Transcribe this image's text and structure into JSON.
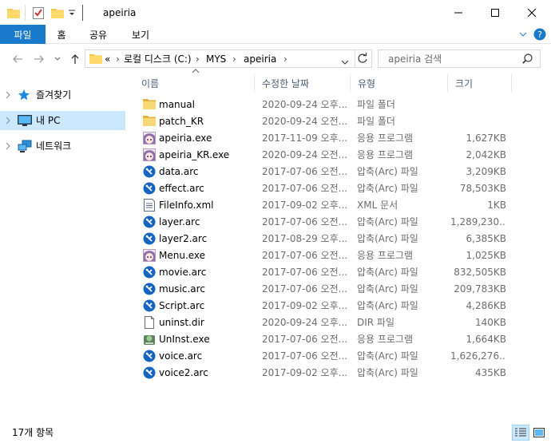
{
  "window": {
    "title": "apeiria",
    "minimize_glyph": "—",
    "maximize_glyph": "☐",
    "close_glyph": "✕"
  },
  "ribbon": {
    "file_tab": "파일",
    "tabs": [
      "홈",
      "공유",
      "보기"
    ],
    "expand_glyph": "⌄",
    "help_glyph": "?"
  },
  "nav": {
    "back_glyph": "←",
    "forward_glyph": "→",
    "recent_glyph": "⌄",
    "up_glyph": "↑",
    "address": {
      "overflow": "«",
      "crumbs": [
        "로컬 디스크 (C:)",
        "MYS",
        "apeiria"
      ],
      "separator": "›"
    },
    "refresh_glyph": "↻",
    "search_placeholder": "apeiria 검색"
  },
  "sidebar": {
    "items": [
      {
        "label": "즐겨찾기",
        "icon": "star-icon"
      },
      {
        "label": "내 PC",
        "icon": "computer-icon",
        "selected": true
      },
      {
        "label": "네트워크",
        "icon": "network-icon"
      }
    ]
  },
  "columns": {
    "name": "이름",
    "date": "수정한 날짜",
    "type": "유형",
    "size": "크기"
  },
  "files": [
    {
      "name": "manual",
      "date": "2020-09-24 오후...",
      "type": "파일 폴더",
      "size": "",
      "icon": "folder-icon"
    },
    {
      "name": "patch_KR",
      "date": "2020-09-24 오전...",
      "type": "파일 폴더",
      "size": "",
      "icon": "folder-icon"
    },
    {
      "name": "apeiria.exe",
      "date": "2017-11-09 오후...",
      "type": "응용 프로그램",
      "size": "1,627KB",
      "icon": "app-face-icon"
    },
    {
      "name": "apeiria_KR.exe",
      "date": "2020-09-24 오전...",
      "type": "응용 프로그램",
      "size": "2,042KB",
      "icon": "app-face-icon"
    },
    {
      "name": "data.arc",
      "date": "2017-07-06 오전...",
      "type": "압축(Arc) 파일",
      "size": "3,209KB",
      "icon": "arc-icon"
    },
    {
      "name": "effect.arc",
      "date": "2017-07-06 오전...",
      "type": "압축(Arc) 파일",
      "size": "78,503KB",
      "icon": "arc-icon"
    },
    {
      "name": "FileInfo.xml",
      "date": "2017-09-02 오후...",
      "type": "XML 문서",
      "size": "1KB",
      "icon": "xml-icon"
    },
    {
      "name": "layer.arc",
      "date": "2017-07-06 오전...",
      "type": "압축(Arc) 파일",
      "size": "1,289,230...",
      "icon": "arc-icon"
    },
    {
      "name": "layer2.arc",
      "date": "2017-08-29 오후...",
      "type": "압축(Arc) 파일",
      "size": "6,385KB",
      "icon": "arc-icon"
    },
    {
      "name": "Menu.exe",
      "date": "2017-07-06 오전...",
      "type": "응용 프로그램",
      "size": "1,025KB",
      "icon": "app-face-icon"
    },
    {
      "name": "movie.arc",
      "date": "2017-07-06 오전...",
      "type": "압축(Arc) 파일",
      "size": "832,505KB",
      "icon": "arc-icon"
    },
    {
      "name": "music.arc",
      "date": "2017-07-06 오전...",
      "type": "압축(Arc) 파일",
      "size": "209,783KB",
      "icon": "arc-icon"
    },
    {
      "name": "Script.arc",
      "date": "2017-09-02 오후...",
      "type": "압축(Arc) 파일",
      "size": "4,286KB",
      "icon": "arc-icon"
    },
    {
      "name": "uninst.dir",
      "date": "2020-09-24 오후...",
      "type": "DIR 파일",
      "size": "140KB",
      "icon": "file-icon"
    },
    {
      "name": "UnInst.exe",
      "date": "2017-07-06 오전...",
      "type": "응용 프로그램",
      "size": "1,664KB",
      "icon": "uninstall-icon"
    },
    {
      "name": "voice.arc",
      "date": "2017-07-06 오전...",
      "type": "압축(Arc) 파일",
      "size": "1,626,276...",
      "icon": "arc-icon"
    },
    {
      "name": "voice2.arc",
      "date": "2017-09-02 오후...",
      "type": "압축(Arc) 파일",
      "size": "435KB",
      "icon": "arc-icon"
    }
  ],
  "status": {
    "count": "17개 항목"
  },
  "colors": {
    "accent": "#1979ca",
    "selection": "#cce8ff",
    "folder": "#f5c94c",
    "arc_icon": "#1565c0"
  }
}
